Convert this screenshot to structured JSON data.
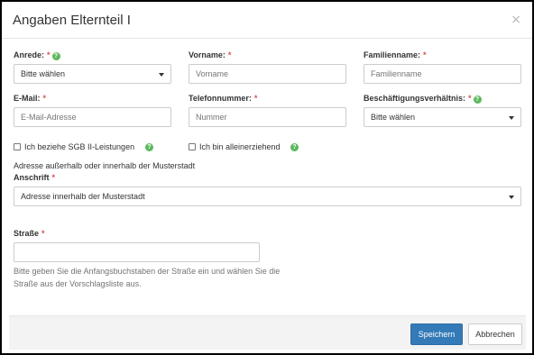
{
  "modal": {
    "title": "Angaben Elternteil I",
    "close": "×"
  },
  "fields": {
    "anrede": {
      "label": "Anrede:",
      "required": "*",
      "value": "Bitte wählen"
    },
    "vorname": {
      "label": "Vorname:",
      "required": "*",
      "placeholder": "Vorname"
    },
    "familienname": {
      "label": "Familienname:",
      "required": "*",
      "placeholder": "Familienname"
    },
    "email": {
      "label": "E-Mail:",
      "required": "*",
      "placeholder": "E-Mail-Adresse"
    },
    "telefon": {
      "label": "Telefonnummer:",
      "required": "*",
      "placeholder": "Nummer"
    },
    "beschaeftigung": {
      "label": "Beschäftigungsverhältnis:",
      "required": "*",
      "value": "Bitte wählen"
    },
    "sgb": {
      "label": "Ich beziehe SGB II-Leistungen"
    },
    "alleinerziehend": {
      "label": "Ich bin alleinerziehend"
    },
    "adresse_hint": "Adresse außerhalb oder innerhalb der Musterstadt",
    "anschrift": {
      "label": "Anschrift",
      "required": "*",
      "value": "Adresse innerhalb der Musterstadt"
    },
    "strasse": {
      "label": "Straße",
      "required": "*",
      "value": ""
    },
    "strasse_hint": "Bitte geben Sie die Anfangsbuchstaben der Straße ein und wählen Sie die Straße aus der Vorschlagsliste aus."
  },
  "footer": {
    "save_label": "Speichern",
    "cancel_label": "Abbrechen"
  },
  "icons": {
    "help": "?",
    "help_color": "#5cb85c",
    "required_color": "#d9534f",
    "primary_color": "#337ab7"
  }
}
